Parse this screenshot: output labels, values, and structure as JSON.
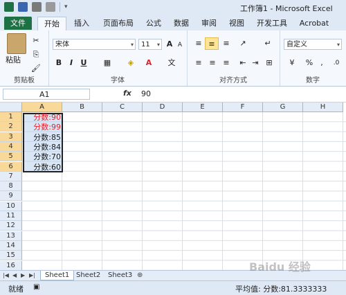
{
  "window": {
    "title": "工作簿1 - Microsoft Excel"
  },
  "qat": {
    "icons": [
      "excel-app-icon",
      "save-icon",
      "undo-icon",
      "redo-icon"
    ]
  },
  "tabs": {
    "file": "文件",
    "items": [
      "开始",
      "插入",
      "页面布局",
      "公式",
      "数据",
      "审阅",
      "视图",
      "开发工具",
      "Acrobat"
    ],
    "active": "开始"
  },
  "ribbon": {
    "clipboard": {
      "label": "剪贴板",
      "paste": "粘贴"
    },
    "font": {
      "label": "字体",
      "name": "宋体",
      "size": "11",
      "bold": "B",
      "italic": "I",
      "underline": "U",
      "grow": "A",
      "shrink": "A"
    },
    "alignment": {
      "label": "对齐方式"
    },
    "number": {
      "label": "数字",
      "format": "自定义",
      "percent": "%",
      "comma": ","
    }
  },
  "formula_bar": {
    "name_box": "A1",
    "fx": "fx",
    "value": "90"
  },
  "grid": {
    "columns": [
      "A",
      "B",
      "C",
      "D",
      "E",
      "F",
      "G",
      "H"
    ],
    "rows": [
      "1",
      "2",
      "3",
      "4",
      "5",
      "6",
      "7",
      "8",
      "9",
      "10",
      "11",
      "12",
      "13",
      "14",
      "15",
      "16"
    ],
    "selected_column": "A",
    "selected_rows": [
      "1",
      "2",
      "3",
      "4",
      "5",
      "6"
    ],
    "data": [
      {
        "text": "分数:90",
        "color": "#e0232a"
      },
      {
        "text": "分数:99",
        "color": "#e0232a"
      },
      {
        "text": "分数:85",
        "color": "#1a1a1a"
      },
      {
        "text": "分数:84",
        "color": "#1a1a1a"
      },
      {
        "text": "分数:70",
        "color": "#1a1a1a"
      },
      {
        "text": "分数:60",
        "color": "#1a1a1a"
      }
    ]
  },
  "sheets": {
    "items": [
      "Sheet1",
      "Sheet2",
      "Sheet3"
    ],
    "active": "Sheet1"
  },
  "status": {
    "mode": "就绪",
    "average": "平均值: 分数:81.3333333"
  },
  "watermark": "Baidu 经验"
}
